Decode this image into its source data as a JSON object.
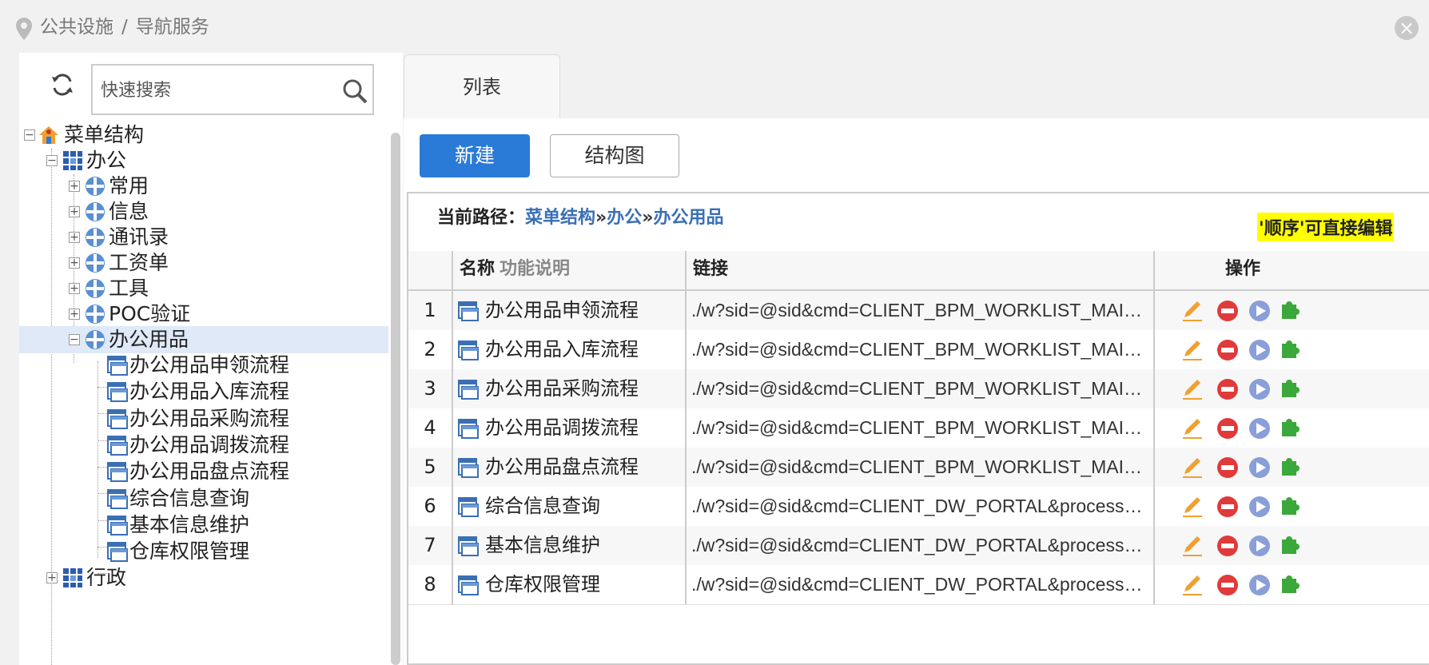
{
  "breadcrumb": [
    "公共设施",
    "导航服务"
  ],
  "breadcrumb_sep": "/",
  "search": {
    "placeholder": "快速搜索"
  },
  "tree": {
    "root": "菜单结构",
    "office": "办公",
    "office_children": [
      "常用",
      "信息",
      "通讯录",
      "工资单",
      "工具",
      "POC验证"
    ],
    "supplies": "办公用品",
    "supplies_children": [
      "办公用品申领流程",
      "办公用品入库流程",
      "办公用品采购流程",
      "办公用品调拨流程",
      "办公用品盘点流程",
      "综合信息查询",
      "基本信息维护",
      "仓库权限管理"
    ],
    "admin": "行政"
  },
  "tab": {
    "label": "列表"
  },
  "toolbar": {
    "new_label": "新建",
    "struct_label": "结构图"
  },
  "path": {
    "label": "当前路径：",
    "links": [
      "菜单结构",
      "办公",
      "办公用品"
    ],
    "sep": "»",
    "hint": "'顺序'可直接编辑"
  },
  "table": {
    "headers": {
      "name": "名称",
      "desc": "功能说明",
      "link": "链接",
      "ops": "操作"
    },
    "rows": [
      {
        "num": "1",
        "name": "办公用品申领流程",
        "link": "./w?sid=@sid&cmd=CLIENT_BPM_WORKLIST_MAIN&p..."
      },
      {
        "num": "2",
        "name": "办公用品入库流程",
        "link": "./w?sid=@sid&cmd=CLIENT_BPM_WORKLIST_MAIN&p..."
      },
      {
        "num": "3",
        "name": "办公用品采购流程",
        "link": "./w?sid=@sid&cmd=CLIENT_BPM_WORKLIST_MAIN&p..."
      },
      {
        "num": "4",
        "name": "办公用品调拨流程",
        "link": "./w?sid=@sid&cmd=CLIENT_BPM_WORKLIST_MAIN&p..."
      },
      {
        "num": "5",
        "name": "办公用品盘点流程",
        "link": "./w?sid=@sid&cmd=CLIENT_BPM_WORKLIST_MAIN&p..."
      },
      {
        "num": "6",
        "name": "综合信息查询",
        "link": "./w?sid=@sid&cmd=CLIENT_DW_PORTAL&processGro..."
      },
      {
        "num": "7",
        "name": "基本信息维护",
        "link": "./w?sid=@sid&cmd=CLIENT_DW_PORTAL&processGro..."
      },
      {
        "num": "8",
        "name": "仓库权限管理",
        "link": "./w?sid=@sid&cmd=CLIENT_DW_PORTAL&processGro..."
      }
    ]
  },
  "colors": {
    "accent": "#2a7ad8",
    "link": "#3a6fb5",
    "hint_bg": "#ffff00",
    "selected_row": "#dfe9f8"
  }
}
